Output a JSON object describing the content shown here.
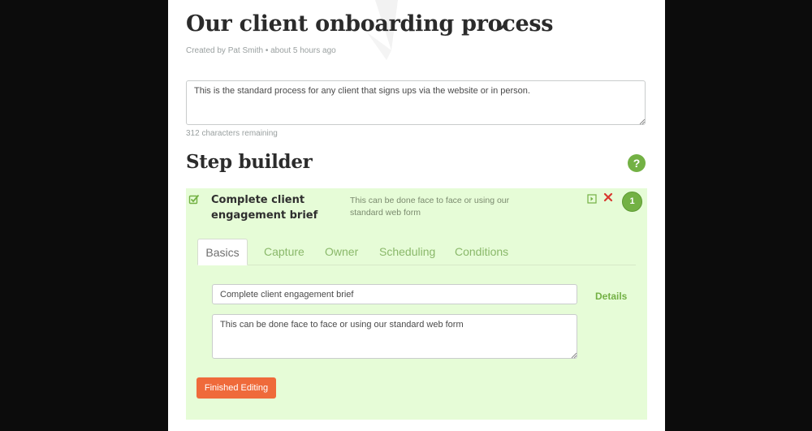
{
  "process": {
    "title": "Our client onboarding process",
    "meta": "Created by Pat Smith • about 5 hours ago",
    "description": "This is the standard process for any client that signs ups via the website or in person.",
    "chars_remaining": "312 characters remaining"
  },
  "step_builder": {
    "heading": "Step builder",
    "help_symbol": "?"
  },
  "step": {
    "number": "1",
    "title": "Complete client engagement brief",
    "subtitle": "This can be done face to face or using our standard web form",
    "tabs": [
      {
        "label": "Basics",
        "active": true
      },
      {
        "label": "Capture",
        "active": false
      },
      {
        "label": "Owner",
        "active": false
      },
      {
        "label": "Scheduling",
        "active": false
      },
      {
        "label": "Conditions",
        "active": false
      }
    ],
    "name_value": "Complete client engagement brief",
    "description_value": "This can be done face to face or using our standard web form",
    "details_label": "Details",
    "finish_label": "Finished Editing"
  },
  "icons": {
    "edit": "pencil-icon",
    "help": "question-icon",
    "check": "checkbox-checked-icon",
    "expand": "expand-icon",
    "close": "close-icon"
  },
  "colors": {
    "accent_green": "#73b144",
    "step_background": "#e6fcd7",
    "tab_text": "#8ab86a",
    "finish_button": "#ef6a3b",
    "close_red": "#d9382f",
    "page_background": "#0c0c0c"
  }
}
